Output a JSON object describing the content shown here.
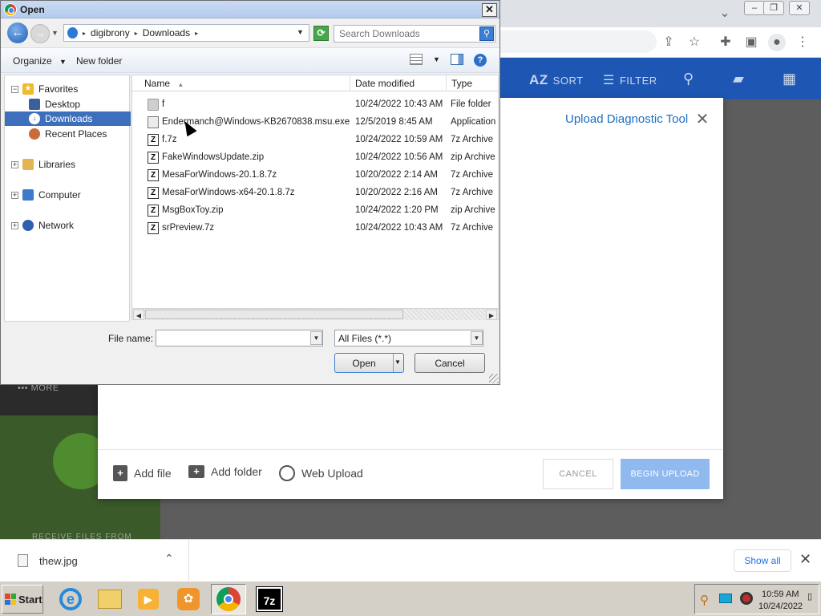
{
  "browser": {
    "extensions": [
      "share-icon",
      "star-icon",
      "puzzle-icon",
      "sidebar-icon",
      "profile-icon",
      "more-icon"
    ]
  },
  "app": {
    "header": {
      "sort_label": "SORT",
      "filter_label": "FILTER",
      "az_label": "AZ"
    },
    "more_label": "MORE",
    "promo_text": "RECEIVE FILES FROM"
  },
  "upload_modal": {
    "title": "Upload Diagnostic Tool",
    "add_file": "Add file",
    "add_folder": "Add folder",
    "web_upload": "Web Upload",
    "cancel": "CANCEL",
    "begin_upload": "BEGIN UPLOAD"
  },
  "download_shelf": {
    "file_name": "thew.jpg",
    "show_all": "Show all"
  },
  "taskbar": {
    "start": "Start",
    "time": "10:59 AM",
    "date": "10/24/2022",
    "seven_zip": "7z"
  },
  "dialog": {
    "title": "Open",
    "breadcrumb": [
      "digibrony",
      "Downloads"
    ],
    "search_placeholder": "Search Downloads",
    "organize": "Organize",
    "new_folder": "New folder",
    "nav": {
      "favorites": "Favorites",
      "desktop": "Desktop",
      "downloads": "Downloads",
      "recent_places": "Recent Places",
      "libraries": "Libraries",
      "computer": "Computer",
      "network": "Network"
    },
    "columns": {
      "name": "Name",
      "date_modified": "Date modified",
      "type": "Type"
    },
    "files": [
      {
        "name": "f",
        "date": "10/24/2022 10:43 AM",
        "type": "File folder",
        "icon": "folder"
      },
      {
        "name": "Endermanch@Windows-KB2670838.msu.exe",
        "date": "12/5/2019 8:45 AM",
        "type": "Application",
        "icon": "exe"
      },
      {
        "name": "f.7z",
        "date": "10/24/2022 10:59 AM",
        "type": "7z Archive",
        "icon": "archive"
      },
      {
        "name": "FakeWindowsUpdate.zip",
        "date": "10/24/2022 10:56 AM",
        "type": "zip Archive",
        "icon": "archive"
      },
      {
        "name": "MesaForWindows-20.1.8.7z",
        "date": "10/20/2022 2:14 AM",
        "type": "7z Archive",
        "icon": "archive"
      },
      {
        "name": "MesaForWindows-x64-20.1.8.7z",
        "date": "10/20/2022 2:16 AM",
        "type": "7z Archive",
        "icon": "archive"
      },
      {
        "name": "MsgBoxToy.zip",
        "date": "10/24/2022 1:20 PM",
        "type": "zip Archive",
        "icon": "archive"
      },
      {
        "name": "srPreview.7z",
        "date": "10/24/2022 10:43 AM",
        "type": "7z Archive",
        "icon": "archive"
      }
    ],
    "file_name_label": "File name:",
    "file_name_value": "",
    "file_type": "All Files (*.*)",
    "open": "Open",
    "cancel": "Cancel"
  },
  "colors": {
    "app_header": "#1d57b3",
    "modal_accent": "#1d6fbf",
    "selection": "#3e6fbc",
    "begin_upload": "#90b9ef"
  }
}
